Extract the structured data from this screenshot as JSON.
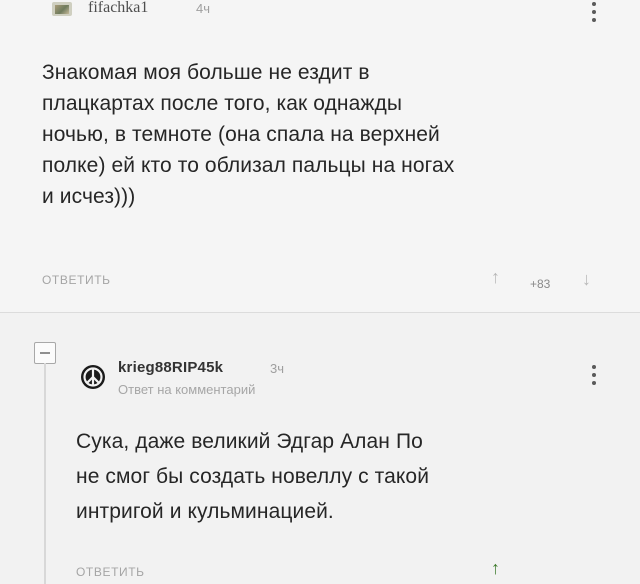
{
  "comment": {
    "username": "fifachka1",
    "time": "4ч",
    "body": "Знакомая моя больше не ездит в\nплацкартах после того, как однажды\nночью, в темноте (она спала на верхней\nполке) ей кто то облизал пальцы на ногах\nи исчез)))",
    "reply_label": "ОТВЕТИТЬ",
    "rating": "+83"
  },
  "reply": {
    "username": "krieg88RIP45k",
    "time": "3ч",
    "subtitle": "Ответ на комментарий",
    "body": "Сука, даже великий Эдгар Алан По\nне смог бы создать новеллу с такой\nинтригой и кульминацией.",
    "reply_label": "ОТВЕТИТЬ"
  },
  "colors": {
    "upvote_active": "#3e7b2d",
    "muted": "#a5a5a5"
  },
  "icons": {
    "upvote": "arrow-up",
    "downvote": "arrow-down",
    "collapse": "minus-box",
    "avatar_reply": "peace-symbol"
  }
}
